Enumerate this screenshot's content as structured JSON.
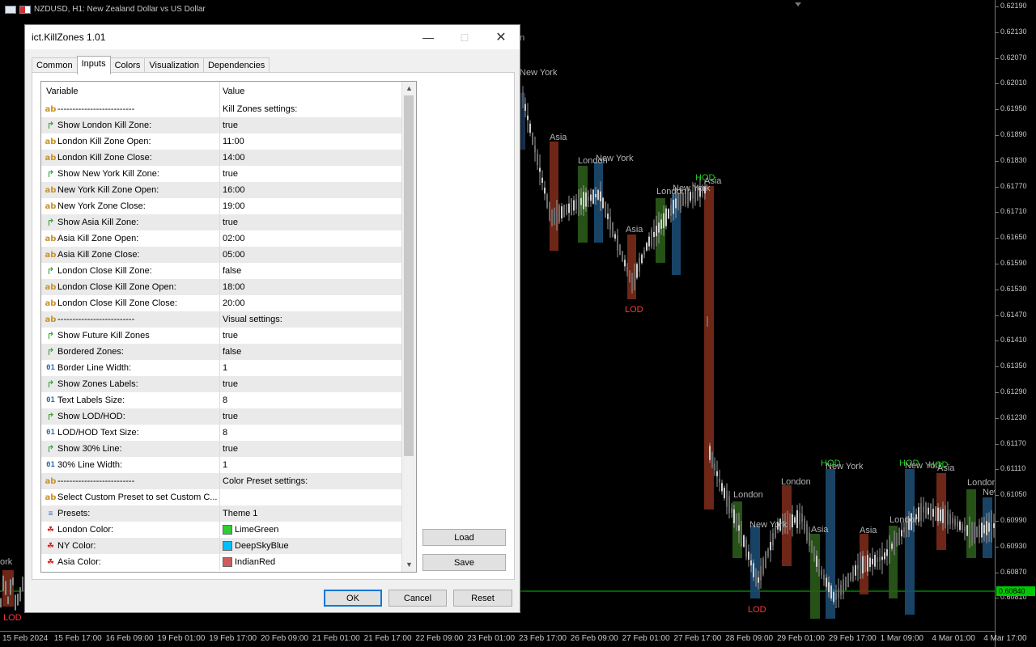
{
  "chart": {
    "header": "NZDUSD, H1:  New Zealand Dollar vs US Dollar",
    "price_labels": [
      "0.62190",
      "0.62130",
      "0.62070",
      "0.62010",
      "0.61950",
      "0.61890",
      "0.61830",
      "0.61770",
      "0.61710",
      "0.61650",
      "0.61590",
      "0.61530",
      "0.61470",
      "0.61410",
      "0.61350",
      "0.61290",
      "0.61230",
      "0.61170",
      "0.61110",
      "0.61050",
      "0.60990",
      "0.60930",
      "0.60870",
      "0.60810"
    ],
    "current_price": "0.60840",
    "time_labels": [
      "15 Feb 2024",
      "15 Feb 17:00",
      "16 Feb 09:00",
      "19 Feb 01:00",
      "19 Feb 17:00",
      "20 Feb 09:00",
      "21 Feb 01:00",
      "21 Feb 17:00",
      "22 Feb 09:00",
      "23 Feb 01:00",
      "23 Feb 17:00",
      "26 Feb 09:00",
      "27 Feb 01:00",
      "27 Feb 17:00",
      "28 Feb 09:00",
      "29 Feb 01:00",
      "29 Feb 17:00",
      "1 Mar 09:00",
      "4 Mar 01:00",
      "4 Mar 17:00"
    ],
    "zone_labels": [
      "New York",
      "Asia",
      "London",
      "New York",
      "London",
      "New York",
      "Asia",
      "Asia",
      "London",
      "New York",
      "London",
      "Asia",
      "New York",
      "Asia",
      "London",
      "New York",
      "London",
      "New",
      "on",
      "Asia",
      "ork"
    ],
    "markers": [
      "HOD",
      "LOD",
      "LOD",
      "HOD",
      "HOD",
      "HOD",
      "LOD"
    ]
  },
  "dialog": {
    "title": "ict.KillZones 1.01",
    "tabs": [
      "Common",
      "Inputs",
      "Colors",
      "Visualization",
      "Dependencies"
    ],
    "active_tab": "Inputs",
    "columns": {
      "variable": "Variable",
      "value": "Value"
    },
    "rows": [
      {
        "icon": "ab",
        "name": "--------------------------",
        "value": "Kill Zones settings:"
      },
      {
        "icon": "bool",
        "name": "Show London Kill Zone:",
        "value": "true"
      },
      {
        "icon": "ab",
        "name": "London Kill Zone Open:",
        "value": "11:00"
      },
      {
        "icon": "ab",
        "name": "London Kill Zone Close:",
        "value": "14:00"
      },
      {
        "icon": "bool",
        "name": "Show New York Kill Zone:",
        "value": "true"
      },
      {
        "icon": "ab",
        "name": "New York Kill Zone Open:",
        "value": "16:00"
      },
      {
        "icon": "ab",
        "name": "New York Zone Close:",
        "value": "19:00"
      },
      {
        "icon": "bool",
        "name": "Show Asia Kill Zone:",
        "value": "true"
      },
      {
        "icon": "ab",
        "name": "Asia Kill Zone Open:",
        "value": "02:00"
      },
      {
        "icon": "ab",
        "name": "Asia Kill Zone Close:",
        "value": "05:00"
      },
      {
        "icon": "bool",
        "name": "London Close Kill Zone:",
        "value": "false"
      },
      {
        "icon": "ab",
        "name": "London Close Kill Zone Open:",
        "value": "18:00"
      },
      {
        "icon": "ab",
        "name": "London Close Kill Zone Close:",
        "value": "20:00"
      },
      {
        "icon": "ab",
        "name": "--------------------------",
        "value": "Visual settings:"
      },
      {
        "icon": "bool",
        "name": "Show Future Kill Zones",
        "value": "true"
      },
      {
        "icon": "bool",
        "name": "Bordered Zones:",
        "value": "false"
      },
      {
        "icon": "num",
        "name": "Border Line Width:",
        "value": "1"
      },
      {
        "icon": "bool",
        "name": "Show Zones Labels:",
        "value": "true"
      },
      {
        "icon": "num",
        "name": "Text Labels Size:",
        "value": "8"
      },
      {
        "icon": "bool",
        "name": "Show LOD/HOD:",
        "value": "true"
      },
      {
        "icon": "num",
        "name": "LOD/HOD Text Size:",
        "value": "8"
      },
      {
        "icon": "bool",
        "name": "Show 30% Line:",
        "value": "true"
      },
      {
        "icon": "num",
        "name": "30% Line Width:",
        "value": "1"
      },
      {
        "icon": "ab",
        "name": "--------------------------",
        "value": "Color Preset settings:"
      },
      {
        "icon": "ab",
        "name": "Select Custom Preset to set Custom C...",
        "value": ""
      },
      {
        "icon": "list",
        "name": "Presets:",
        "value": "Theme 1"
      },
      {
        "icon": "color",
        "name": "London Color:",
        "value": "LimeGreen",
        "swatch": "#32cd32"
      },
      {
        "icon": "color",
        "name": "NY Color:",
        "value": "DeepSkyBlue",
        "swatch": "#00bfff"
      },
      {
        "icon": "color",
        "name": "Asia Color:",
        "value": "IndianRed",
        "swatch": "#cd5c5c"
      }
    ],
    "buttons": {
      "load": "Load",
      "save": "Save",
      "ok": "OK",
      "cancel": "Cancel",
      "reset": "Reset"
    }
  }
}
